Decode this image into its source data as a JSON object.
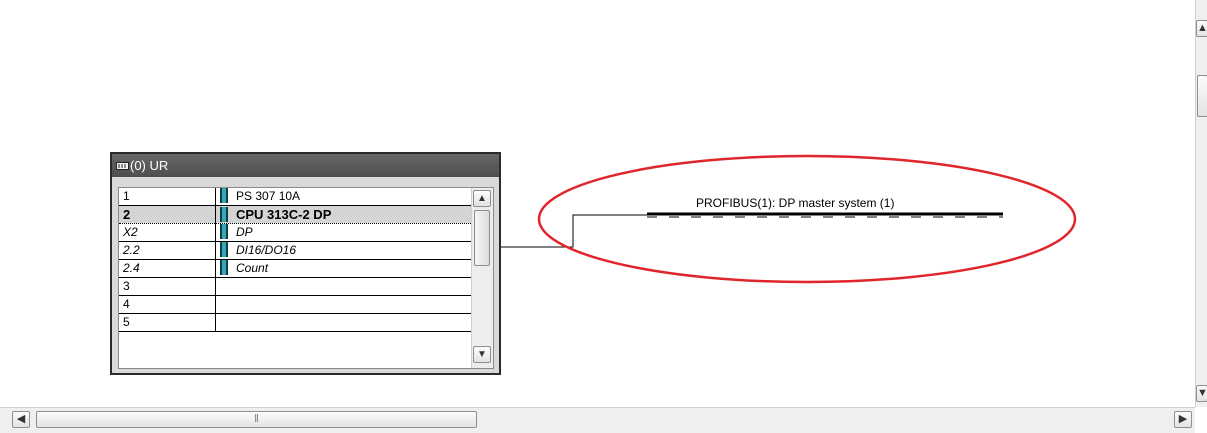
{
  "rack": {
    "title": "(0) UR",
    "rows": [
      {
        "slot": "1",
        "module": "PS 307 10A",
        "has_icon": true,
        "selected": false,
        "sub": false
      },
      {
        "slot": "2",
        "module": "CPU 313C-2 DP",
        "has_icon": true,
        "selected": true,
        "sub": false
      },
      {
        "slot": "X2",
        "module": "DP",
        "has_icon": true,
        "selected": false,
        "sub": true
      },
      {
        "slot": "2.2",
        "module": "DI16/DO16",
        "has_icon": true,
        "selected": false,
        "sub": true
      },
      {
        "slot": "2.4",
        "module": "Count",
        "has_icon": true,
        "selected": false,
        "sub": true
      },
      {
        "slot": "3",
        "module": "",
        "has_icon": false,
        "selected": false,
        "sub": false
      },
      {
        "slot": "4",
        "module": "",
        "has_icon": false,
        "selected": false,
        "sub": false
      },
      {
        "slot": "5",
        "module": "",
        "has_icon": false,
        "selected": false,
        "sub": false
      }
    ]
  },
  "profibus": {
    "label": "PROFIBUS(1): DP master system (1)"
  },
  "highlight_color": "#e0262b",
  "icons": {
    "rack": "rack-icon",
    "module": "module-icon",
    "scroll_up": "chevron-up-icon",
    "scroll_down": "chevron-down-icon",
    "scroll_left": "chevron-left-icon",
    "scroll_right": "chevron-right-icon"
  }
}
